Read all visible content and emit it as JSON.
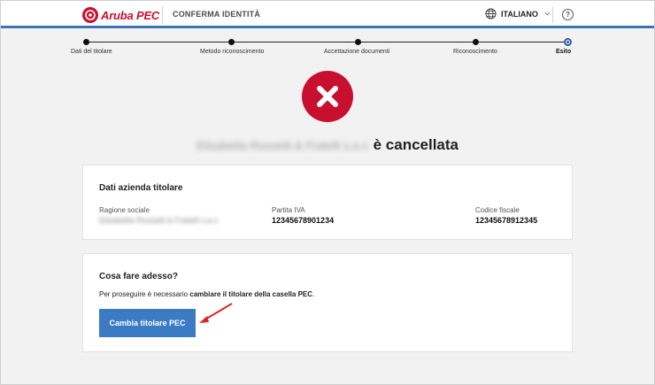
{
  "header": {
    "logo_text": "Aruba PEC",
    "title": "CONFERMA IDENTITÀ",
    "language": "ITALIANO",
    "help_glyph": "?",
    "icons": {
      "globe": "globe-icon",
      "chevron": "chevron-down-icon",
      "help": "help-icon"
    },
    "accent_color": "#3b73b5"
  },
  "stepper": {
    "steps": [
      {
        "label": "Dati del titolare",
        "state": "done"
      },
      {
        "label": "Metodo riconoscimento",
        "state": "done"
      },
      {
        "label": "Accettazione documenti",
        "state": "done"
      },
      {
        "label": "Riconoscimento",
        "state": "done"
      },
      {
        "label": "Esito",
        "state": "current"
      }
    ]
  },
  "status": {
    "icon": "error-x-icon",
    "icon_color": "#c8102e",
    "subject_redacted": "Elisabetta Rossetti & Fratelli s.a.s",
    "suffix": "è cancellata"
  },
  "company_card": {
    "title": "Dati azienda titolare",
    "fields": [
      {
        "label": "Ragione sociale",
        "value": "Elisabetta Rossetti & Fratelli s.a.s",
        "redacted": true
      },
      {
        "label": "Partita IVA",
        "value": "12345678901234",
        "redacted": false
      },
      {
        "label": "Codice fiscale",
        "value": "12345678912345",
        "redacted": false
      }
    ]
  },
  "next_card": {
    "title": "Cosa fare adesso?",
    "text_prefix": "Per proseguire è necessario ",
    "text_bold": "cambiare il titolare della casella PEC",
    "text_suffix": ".",
    "button_label": "Cambia titolare PEC",
    "button_color": "#3b7bc4",
    "annotation_arrow_color": "#d9262c"
  }
}
